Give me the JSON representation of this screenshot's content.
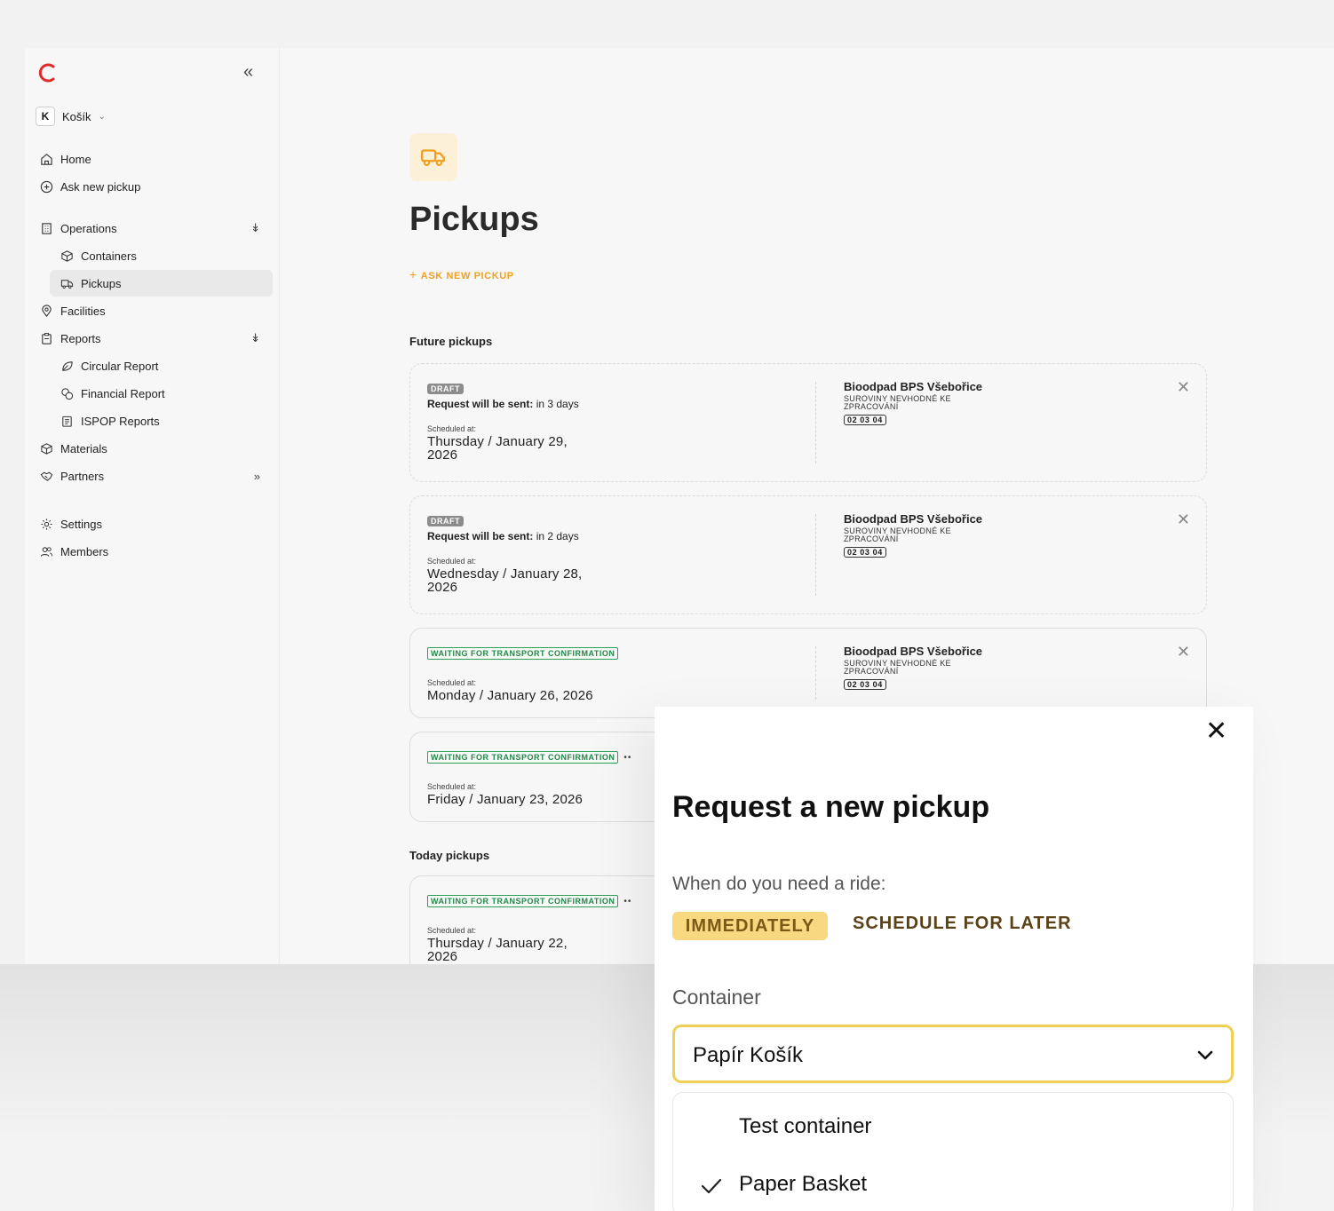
{
  "workspace": {
    "initial": "K",
    "name": "Košík"
  },
  "sidebar": {
    "items": [
      {
        "label": "Home"
      },
      {
        "label": "Ask new pickup"
      },
      {
        "label": "Operations"
      },
      {
        "label": "Containers"
      },
      {
        "label": "Pickups"
      },
      {
        "label": "Facilities"
      },
      {
        "label": "Reports"
      },
      {
        "label": "Circular Report"
      },
      {
        "label": "Financial Report"
      },
      {
        "label": "ISPOP Reports"
      },
      {
        "label": "Materials"
      },
      {
        "label": "Partners"
      },
      {
        "label": "Settings"
      },
      {
        "label": "Members"
      }
    ]
  },
  "page": {
    "title": "Pickups",
    "ask_link": "ASK NEW PICKUP",
    "future_label": "Future pickups",
    "today_label": "Today pickups"
  },
  "cards": [
    {
      "status": "DRAFT",
      "send_prefix": "Request will be sent:",
      "send_value": " in 3 days",
      "sched_label": "Scheduled at:",
      "date_line1": "Thursday / January 29,",
      "date_line2": "2026",
      "facility": "Bioodpad BPS Všebořice",
      "material": "SUROVINY NEVHODNÉ KE ZPRACOVÁNÍ",
      "code": "02 03 04"
    },
    {
      "status": "DRAFT",
      "send_prefix": "Request will be sent:",
      "send_value": " in 2 days",
      "sched_label": "Scheduled at:",
      "date_line1": "Wednesday / January 28,",
      "date_line2": "2026",
      "facility": "Bioodpad BPS Všebořice",
      "material": "SUROVINY NEVHODNÉ KE ZPRACOVÁNÍ",
      "code": "02 03 04"
    },
    {
      "status": "WAITING FOR TRANSPORT CONFIRMATION",
      "sched_label": "Scheduled at:",
      "date_line1": "Monday / January 26, 2026",
      "facility": "Bioodpad BPS Všebořice",
      "material": "SUROVINY NEVHODNÉ KE ZPRACOVÁNÍ",
      "code": "02 03 04"
    },
    {
      "status": "WAITING FOR TRANSPORT CONFIRMATION",
      "sched_label": "Scheduled at:",
      "date_line1": "Friday / January 23, 2026"
    },
    {
      "status": "WAITING FOR TRANSPORT CONFIRMATION",
      "sched_label": "Scheduled at:",
      "date_line1": "Thursday / January 22,",
      "date_line2": "2026"
    }
  ],
  "modal": {
    "title": "Request a new pickup",
    "ride_label": "When do you need a ride:",
    "opt_immediately": "IMMEDIATELY",
    "opt_later": "SCHEDULE FOR LATER",
    "container_label": "Container",
    "selected": "Papír Košík",
    "options": [
      "Test container",
      "Paper Basket"
    ]
  },
  "colors": {
    "accent": "#f0a020",
    "logo": "#e02a2a",
    "select_border": "#f0cf55",
    "immediately_bg": "#f9d882",
    "status_green": "#24864a"
  }
}
